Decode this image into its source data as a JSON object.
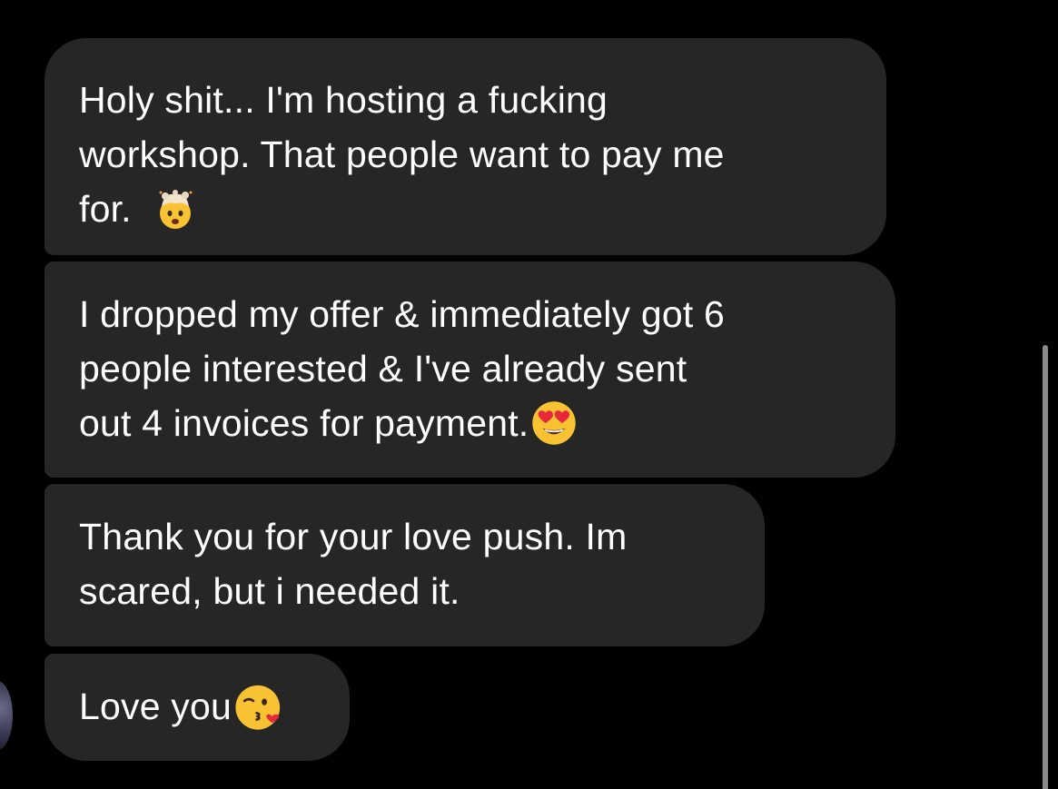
{
  "messages": [
    {
      "lines": [
        "Holy shit... I'm hosting a fucking",
        "workshop. That people want to pay me",
        "for."
      ],
      "emoji": "exploding-head-emoji"
    },
    {
      "lines": [
        "I dropped my offer & immediately got 6",
        "people interested & I've already sent",
        "out 4 invoices for payment."
      ],
      "emoji": "heart-eyes-emoji"
    },
    {
      "lines": [
        "Thank you for your love push. Im",
        "scared, but i needed it."
      ],
      "emoji": null
    },
    {
      "lines": [
        "Love you"
      ],
      "emoji": "kissing-heart-emoji"
    }
  ],
  "colors": {
    "background": "#000000",
    "bubble": "#262626",
    "text": "#ffffff",
    "scrollbar": "#8a8a8a"
  }
}
